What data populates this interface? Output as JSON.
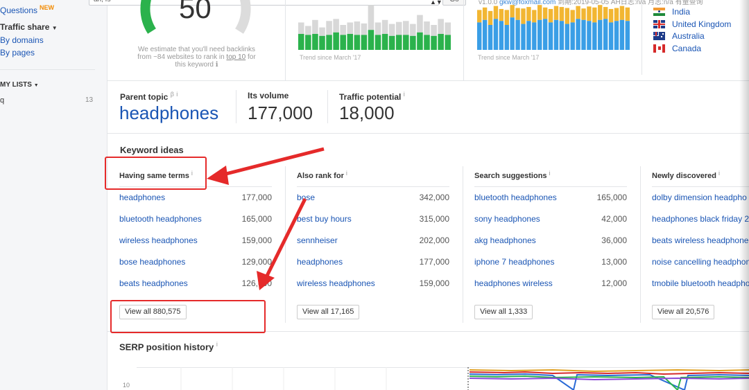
{
  "search": {
    "value": "an, fs",
    "go_label": "Go"
  },
  "sidebar": {
    "questions": "Questions",
    "new_badge": "NEW",
    "traffic_share": "Traffic share",
    "by_domains": "By domains",
    "by_pages": "By pages",
    "my_lists": "MY LISTS",
    "list_name": "q",
    "list_count": "13"
  },
  "difficulty": {
    "score": "50",
    "note_line1": "We estimate that you'll need backlinks",
    "note_line2_prefix": "from ~84 websites to rank in",
    "note_link": "top 10",
    "note_line2_suffix": "for",
    "note_line3": "this keyword",
    "gauge_color": "#2bb24c"
  },
  "volume_trend": {
    "caption": "Trend since March '17",
    "bars": [
      0.55,
      0.48,
      0.6,
      0.45,
      0.58,
      0.62,
      0.5,
      0.55,
      0.57,
      0.53,
      0.9,
      0.55,
      0.6,
      0.52,
      0.56,
      0.58,
      0.52,
      0.7,
      0.57,
      0.5,
      0.62,
      0.55
    ],
    "fill": [
      0.32,
      0.3,
      0.32,
      0.28,
      0.3,
      0.35,
      0.3,
      0.32,
      0.3,
      0.3,
      0.4,
      0.3,
      0.32,
      0.28,
      0.3,
      0.3,
      0.28,
      0.35,
      0.3,
      0.28,
      0.32,
      0.3
    ],
    "top_color": "#d8d8d8",
    "fill_color": "#2bb24c"
  },
  "clicks_trend": {
    "caption": "Trend since March '17",
    "meta": "v1.0.0",
    "email": "gkw@foxmail.com",
    "meta_rest": "到期:2019-05-05 AH日志:n/a 月志:n/a 有量查询",
    "bars": [
      0.8,
      0.85,
      0.78,
      0.88,
      0.82,
      0.8,
      0.9,
      0.84,
      0.83,
      0.86,
      0.8,
      0.9,
      0.85,
      0.82,
      0.88,
      0.86,
      0.84,
      0.8,
      0.88,
      0.83,
      0.87,
      0.85,
      0.9,
      0.86,
      0.82,
      0.84,
      0.88,
      0.85
    ],
    "blue": [
      0.55,
      0.6,
      0.5,
      0.62,
      0.58,
      0.5,
      0.65,
      0.6,
      0.52,
      0.58,
      0.55,
      0.6,
      0.62,
      0.55,
      0.6,
      0.58,
      0.52,
      0.55,
      0.62,
      0.6,
      0.58,
      0.55,
      0.6,
      0.62,
      0.55,
      0.58,
      0.6,
      0.58
    ],
    "top_color": "#f2b632",
    "blue_color": "#3a9ee6"
  },
  "countries": [
    {
      "name": "India",
      "flag": "in"
    },
    {
      "name": "United Kingdom",
      "flag": "uk"
    },
    {
      "name": "Australia",
      "flag": "au"
    },
    {
      "name": "Canada",
      "flag": "ca"
    }
  ],
  "parent_topic": {
    "label": "Parent topic",
    "sup": "β",
    "info": "i",
    "value": "headphones",
    "volume_label": "Its volume",
    "volume_value": "177,000",
    "traffic_label": "Traffic potential",
    "traffic_value": "18,000"
  },
  "keyword_ideas": {
    "title": "Keyword ideas",
    "info": "i",
    "columns": [
      {
        "title": "Having same terms",
        "rows": [
          {
            "keyword": "headphones",
            "volume": "177,000"
          },
          {
            "keyword": "bluetooth headphones",
            "volume": "165,000"
          },
          {
            "keyword": "wireless headphones",
            "volume": "159,000"
          },
          {
            "keyword": "bose headphones",
            "volume": "129,000"
          },
          {
            "keyword": "beats headphones",
            "volume": "126,000"
          }
        ],
        "view_all": "View all 880,575"
      },
      {
        "title": "Also rank for",
        "rows": [
          {
            "keyword": "bose",
            "volume": "342,000"
          },
          {
            "keyword": "best buy hours",
            "volume": "315,000"
          },
          {
            "keyword": "sennheiser",
            "volume": "202,000"
          },
          {
            "keyword": "headphones",
            "volume": "177,000"
          },
          {
            "keyword": "wireless headphones",
            "volume": "159,000"
          }
        ],
        "view_all": "View all 17,165"
      },
      {
        "title": "Search suggestions",
        "rows": [
          {
            "keyword": "bluetooth headphones",
            "volume": "165,000"
          },
          {
            "keyword": "sony headphones",
            "volume": "42,000"
          },
          {
            "keyword": "akg headphones",
            "volume": "36,000"
          },
          {
            "keyword": "iphone 7 headphones",
            "volume": "13,000"
          },
          {
            "keyword": "headphones wireless",
            "volume": "12,000"
          }
        ],
        "view_all": "View all 1,333"
      },
      {
        "title": "Newly discovered",
        "rows": [
          {
            "keyword": "dolby dimension headpho",
            "volume": ""
          },
          {
            "keyword": "headphones black friday 2",
            "volume": ""
          },
          {
            "keyword": "beats wireless headphone",
            "volume": ""
          },
          {
            "keyword": "noise cancelling headphon",
            "volume": ""
          },
          {
            "keyword": "tmobile bluetooth headpho",
            "volume": ""
          }
        ],
        "view_all": "View all 20,576"
      }
    ]
  },
  "serp": {
    "title": "SERP position history",
    "info": "i",
    "y_tick": "10"
  },
  "annotation_color": "#e52a2a"
}
